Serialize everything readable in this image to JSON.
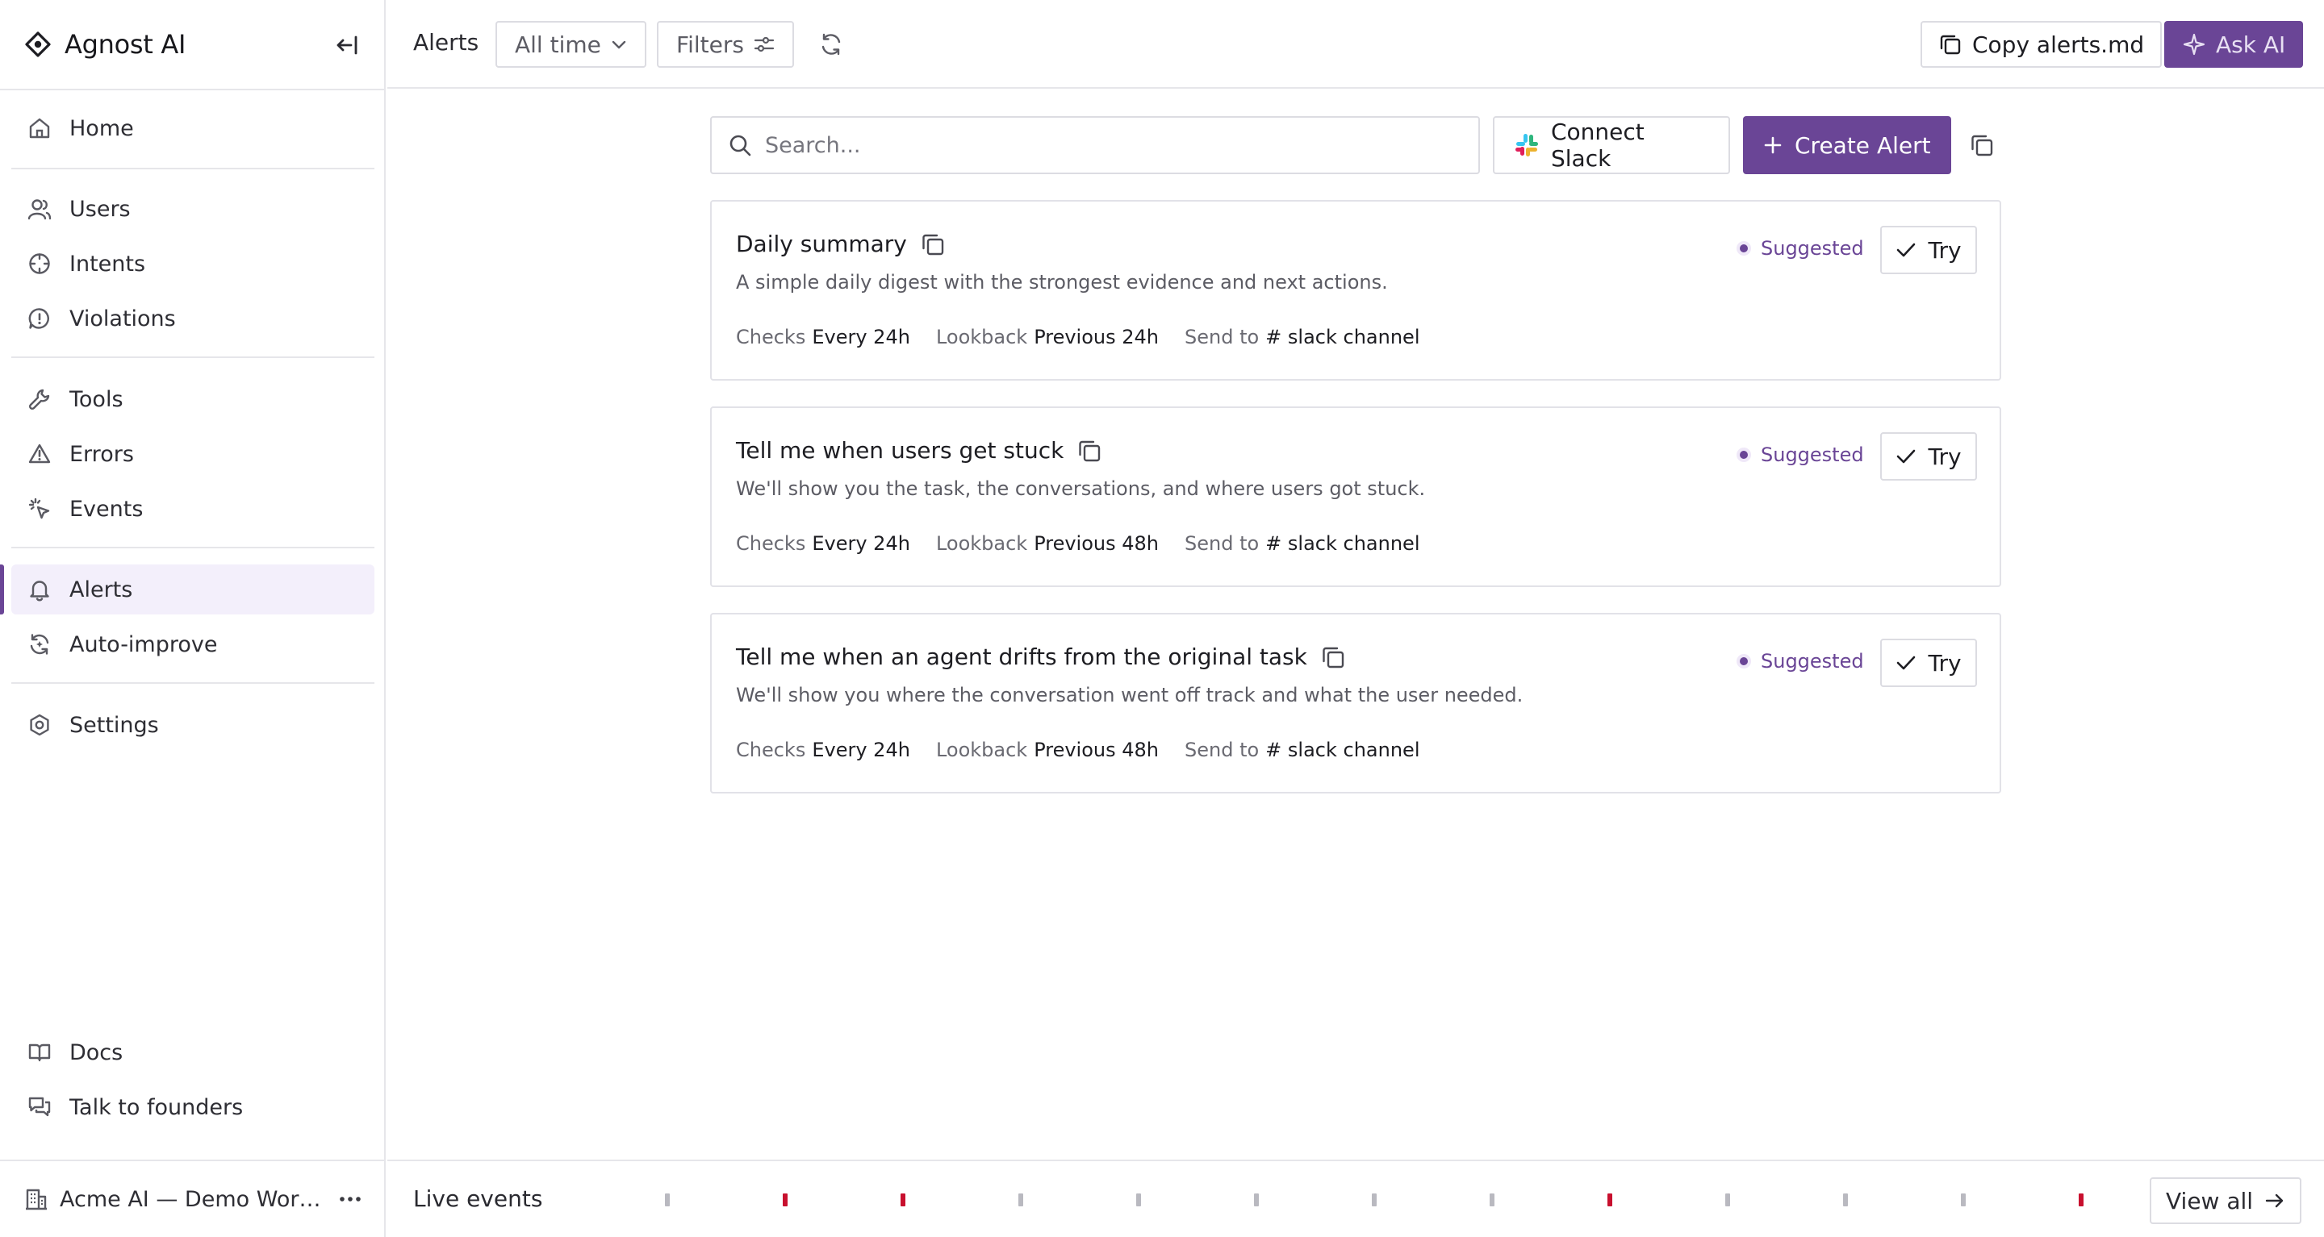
{
  "app": {
    "name": "Agnost AI"
  },
  "nav": {
    "home": "Home",
    "users": "Users",
    "intents": "Intents",
    "violations": "Violations",
    "tools": "Tools",
    "errors": "Errors",
    "events": "Events",
    "alerts": "Alerts",
    "auto_improve": "Auto-improve",
    "settings": "Settings",
    "docs": "Docs",
    "talk": "Talk to founders",
    "active": "Alerts"
  },
  "workspace": {
    "name": "Acme AI — Demo Work..."
  },
  "topbar": {
    "title": "Alerts",
    "time_filter": "All time",
    "filters": "Filters",
    "copy": "Copy alerts.md",
    "ask_ai": "Ask AI"
  },
  "search": {
    "placeholder": "Search..."
  },
  "actions": {
    "connect_slack": "Connect Slack",
    "create_alert": "Create Alert"
  },
  "labels": {
    "checks": "Checks",
    "lookback": "Lookback",
    "send_to": "Send to",
    "suggested": "Suggested",
    "try": "Try"
  },
  "alerts": [
    {
      "title": "Daily summary",
      "description": "A simple daily digest with the strongest evidence and next actions.",
      "checks": "Every 24h",
      "lookback": "Previous 24h",
      "channel": "# slack channel"
    },
    {
      "title": "Tell me when users get stuck",
      "description": "We'll show you the task, the conversations, and where users got stuck.",
      "checks": "Every 24h",
      "lookback": "Previous 48h",
      "channel": "# slack channel"
    },
    {
      "title": "Tell me when an agent drifts from the original task",
      "description": "We'll show you where the conversation went off track and what the user needed.",
      "checks": "Every 24h",
      "lookback": "Previous 48h",
      "channel": "# slack channel"
    }
  ],
  "bottombar": {
    "label": "Live events",
    "view_all": "View all",
    "events": [
      "normal",
      "error",
      "error",
      "normal",
      "normal",
      "normal",
      "normal",
      "normal",
      "error",
      "normal",
      "normal",
      "normal",
      "error"
    ]
  },
  "colors": {
    "accent": "#6a4596",
    "accent_light": "#f3effb",
    "event_normal": "#b9b9c0",
    "event_error": "#c8102e",
    "border": "#e2e2e8"
  }
}
